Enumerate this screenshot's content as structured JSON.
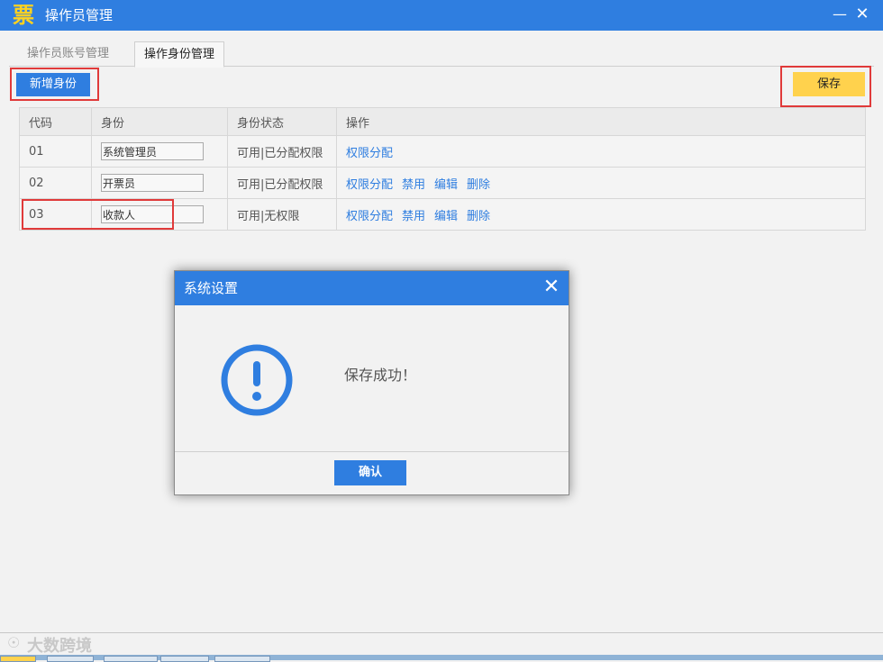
{
  "window": {
    "logo_text": "票",
    "title": "操作员管理",
    "minimize": "—",
    "close": "✕"
  },
  "tabs": [
    {
      "label": "操作员账号管理"
    },
    {
      "label": "操作身份管理"
    }
  ],
  "toolbar": {
    "add_label": "新增身份",
    "save_label": "保存"
  },
  "table": {
    "headers": [
      "代码",
      "身份",
      "身份状态",
      "操作"
    ],
    "rows": [
      {
        "code": "01",
        "role": "系统管理员",
        "status": "可用|已分配权限",
        "actions": [
          "权限分配"
        ]
      },
      {
        "code": "02",
        "role": "开票员",
        "status": "可用|已分配权限",
        "actions": [
          "权限分配",
          "禁用",
          "编辑",
          "删除"
        ]
      },
      {
        "code": "03",
        "role": "收款人",
        "status": "可用|无权限",
        "actions": [
          "权限分配",
          "禁用",
          "编辑",
          "删除"
        ]
      }
    ]
  },
  "dialog": {
    "title": "系统设置",
    "close": "✕",
    "icon": "exclamation-circle-icon",
    "message": "保存成功！",
    "ok_label": "确认"
  },
  "watermark": {
    "glyph": "☉",
    "text": "大数跨境"
  },
  "colors": {
    "accent": "#2f7ee0",
    "save": "#ffd24d",
    "highlight": "#e03a3a",
    "logo": "#ffd21f"
  }
}
